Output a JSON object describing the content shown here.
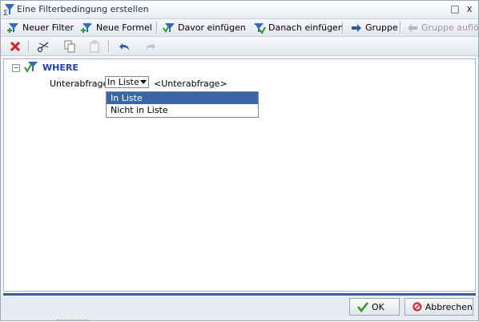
{
  "window": {
    "title": "Eine Filterbedingung erstellen",
    "title_icon": "sigma-filter-icon",
    "minimize_glyph": "□",
    "close_glyph": "x"
  },
  "toolbar": {
    "new_filter": "Neuer Filter",
    "new_formula": "Neue Formel",
    "insert_before": "Davor einfügen",
    "insert_after": "Danach einfügen",
    "group": "Gruppe",
    "ungroup": "Gruppe auflösen"
  },
  "edit_toolbar": {
    "icons": [
      "delete-icon",
      "cut-icon",
      "copy-icon",
      "paste-icon",
      "undo-icon",
      "redo-icon"
    ]
  },
  "tree": {
    "toggle": "−",
    "root_label": "WHERE",
    "row": {
      "label": "Unterabfrage",
      "selected_value": "In Liste",
      "subquery": "<Unterabfrage>"
    },
    "dropdown_options": [
      "In Liste",
      "Nicht in Liste"
    ]
  },
  "footer": {
    "ok": "OK",
    "cancel": "Abbrechen"
  },
  "colors": {
    "accent_blue": "#3e5f95",
    "where_text": "#1f3fbf",
    "selection": "#3a66a8"
  }
}
